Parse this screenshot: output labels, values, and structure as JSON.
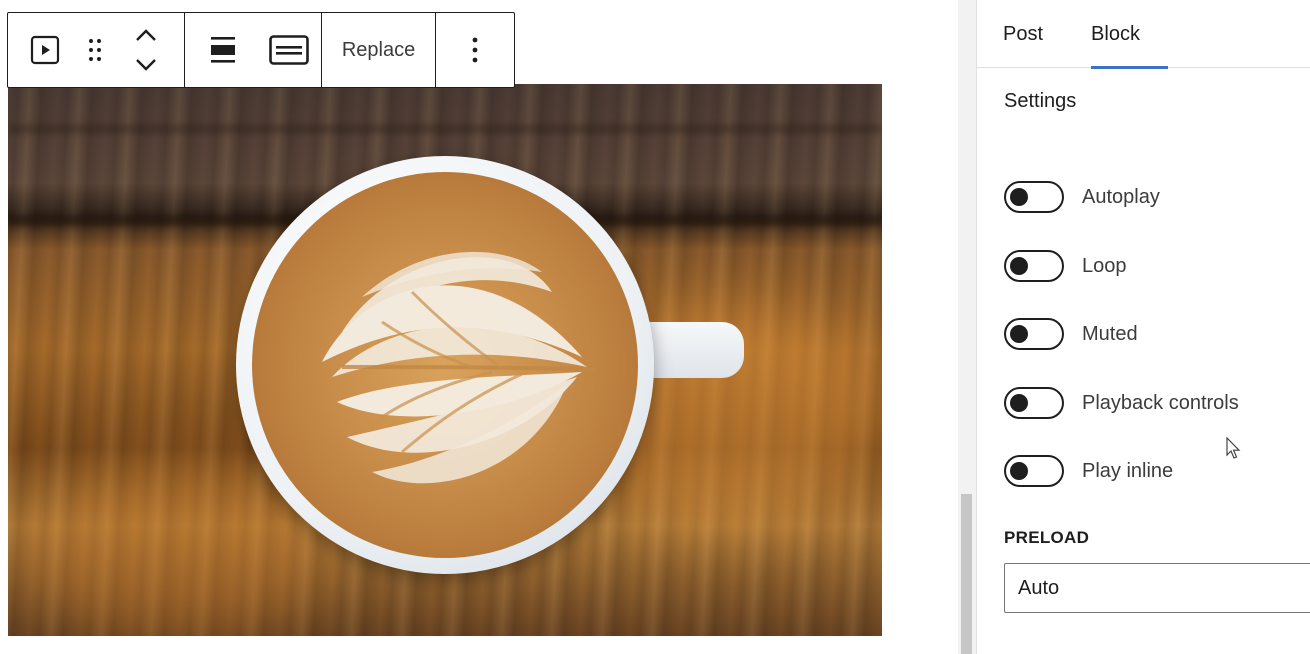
{
  "toolbar": {
    "block_type_icon": "video-icon",
    "drag_icon": "drag-handle-icon",
    "move_icon": "chevron-up-down-icon",
    "align_wide_icon": "align-wide-icon",
    "align_full_icon": "align-full-icon",
    "replace_label": "Replace",
    "more_icon": "more-vertical-icon"
  },
  "sidebar": {
    "tabs": [
      {
        "label": "Post",
        "active": false
      },
      {
        "label": "Block",
        "active": true
      }
    ],
    "section_title": "Settings",
    "toggles": [
      {
        "label": "Autoplay",
        "checked": false
      },
      {
        "label": "Loop",
        "checked": false
      },
      {
        "label": "Muted",
        "checked": false
      },
      {
        "label": "Playback controls",
        "checked": false
      },
      {
        "label": "Play inline",
        "checked": false
      }
    ],
    "preload": {
      "label": "PRELOAD",
      "value": "Auto"
    }
  },
  "colors": {
    "accent": "#3a72c4",
    "text": "#1e1e1e",
    "border": "#e0e0e0"
  }
}
